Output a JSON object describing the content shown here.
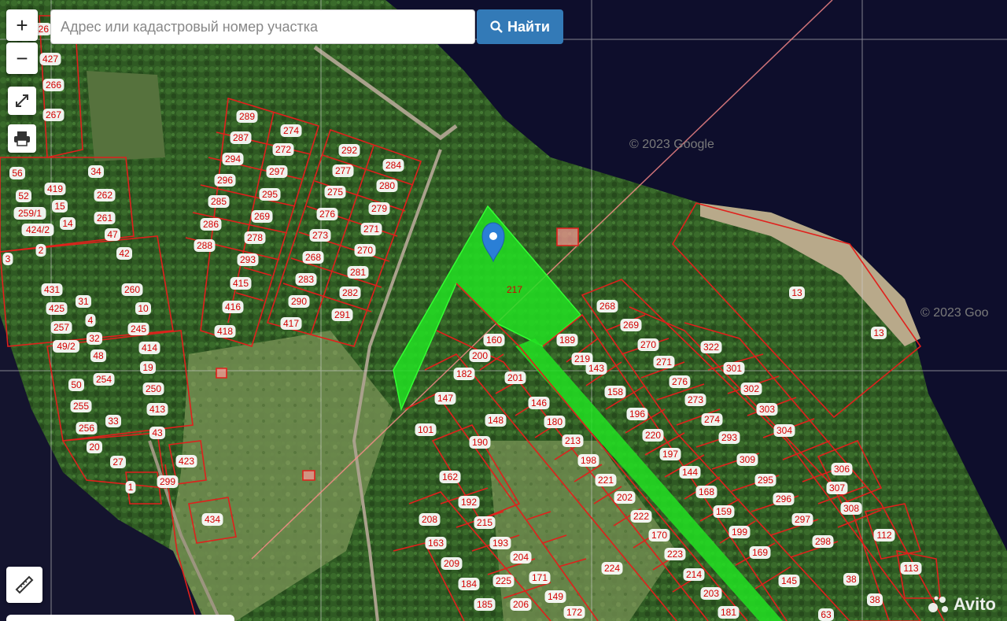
{
  "search": {
    "placeholder": "Адрес или кадастровый номер участка",
    "button_label": "Найти"
  },
  "controls": {
    "zoom_in": "+",
    "zoom_out": "−"
  },
  "watermarks": [
    "© 2023 Google",
    "© 2023 Goo"
  ],
  "avito_logo_text": "Avito",
  "highlighted_parcel": "217",
  "colors": {
    "parcel_outline": "#e0201c",
    "highlight_fill": "#22e022",
    "water": "#0e0e2c",
    "button": "#337ab7"
  },
  "parcels": [
    [
      "427",
      "64",
      "75"
    ],
    [
      "426",
      "52",
      "37"
    ],
    [
      "266",
      "68",
      "108"
    ],
    [
      "267",
      "68",
      "146"
    ],
    [
      "56",
      "22",
      "220"
    ],
    [
      "52",
      "30",
      "249"
    ],
    [
      "419",
      "70",
      "240"
    ],
    [
      "34",
      "122",
      "218"
    ],
    [
      "262",
      "133",
      "248"
    ],
    [
      "259/1",
      "38",
      "271"
    ],
    [
      "15",
      "76",
      "262"
    ],
    [
      "261",
      "133",
      "277"
    ],
    [
      "424/2",
      "48",
      "292"
    ],
    [
      "14",
      "86",
      "284"
    ],
    [
      "47",
      "143",
      "298"
    ],
    [
      "3",
      "10",
      "329"
    ],
    [
      "2",
      "52",
      "318"
    ],
    [
      "42",
      "158",
      "322"
    ],
    [
      "431",
      "66",
      "368"
    ],
    [
      "260",
      "168",
      "368"
    ],
    [
      "31",
      "106",
      "383"
    ],
    [
      "425",
      "72",
      "392"
    ],
    [
      "10",
      "182",
      "392"
    ],
    [
      "257",
      "78",
      "416"
    ],
    [
      "4",
      "115",
      "407"
    ],
    [
      "245",
      "176",
      "418"
    ],
    [
      "49/2",
      "84",
      "440"
    ],
    [
      "32",
      "120",
      "430"
    ],
    [
      "414",
      "190",
      "442"
    ],
    [
      "48",
      "125",
      "452"
    ],
    [
      "19",
      "188",
      "467"
    ],
    [
      "254",
      "132",
      "482"
    ],
    [
      "50",
      "97",
      "489"
    ],
    [
      "250",
      "195",
      "494"
    ],
    [
      "255",
      "103",
      "516"
    ],
    [
      "413",
      "200",
      "520"
    ],
    [
      "33",
      "144",
      "535"
    ],
    [
      "256",
      "110",
      "544"
    ],
    [
      "43",
      "200",
      "550"
    ],
    [
      "20",
      "120",
      "568"
    ],
    [
      "27",
      "150",
      "587"
    ],
    [
      "423",
      "237",
      "586"
    ],
    [
      "299",
      "213",
      "612"
    ],
    [
      "1",
      "166",
      "619"
    ],
    [
      "434",
      "270",
      "660"
    ],
    [
      "289",
      "314",
      "148"
    ],
    [
      "274",
      "370",
      "166"
    ],
    [
      "287",
      "306",
      "175"
    ],
    [
      "272",
      "360",
      "190"
    ],
    [
      "294",
      "296",
      "202"
    ],
    [
      "297",
      "352",
      "218"
    ],
    [
      "296",
      "286",
      "229"
    ],
    [
      "295",
      "343",
      "247"
    ],
    [
      "285",
      "278",
      "256"
    ],
    [
      "269",
      "333",
      "275"
    ],
    [
      "286",
      "268",
      "285"
    ],
    [
      "278",
      "324",
      "302"
    ],
    [
      "288",
      "260",
      "312"
    ],
    [
      "293",
      "315",
      "330"
    ],
    [
      "415",
      "306",
      "360"
    ],
    [
      "416",
      "296",
      "390"
    ],
    [
      "418",
      "286",
      "421"
    ],
    [
      "292",
      "444",
      "191"
    ],
    [
      "284",
      "500",
      "210"
    ],
    [
      "277",
      "436",
      "217"
    ],
    [
      "280",
      "492",
      "236"
    ],
    [
      "275",
      "426",
      "244"
    ],
    [
      "279",
      "482",
      "265"
    ],
    [
      "276",
      "416",
      "272"
    ],
    [
      "271",
      "472",
      "291"
    ],
    [
      "273",
      "407",
      "299"
    ],
    [
      "270",
      "464",
      "318"
    ],
    [
      "268",
      "398",
      "327"
    ],
    [
      "281",
      "455",
      "346"
    ],
    [
      "283",
      "389",
      "355"
    ],
    [
      "282",
      "445",
      "372"
    ],
    [
      "290",
      "380",
      "383"
    ],
    [
      "291",
      "435",
      "400"
    ],
    [
      "417",
      "370",
      "411"
    ],
    [
      "217",
      "654",
      "368"
    ],
    [
      "268",
      "772",
      "389"
    ],
    [
      "269",
      "802",
      "413"
    ],
    [
      "189",
      "721",
      "432"
    ],
    [
      "270",
      "824",
      "438"
    ],
    [
      "322",
      "904",
      "441"
    ],
    [
      "219",
      "740",
      "456"
    ],
    [
      "143",
      "758",
      "468"
    ],
    [
      "271",
      "844",
      "460"
    ],
    [
      "301",
      "933",
      "468"
    ],
    [
      "13",
      "1013",
      "372"
    ],
    [
      "13",
      "1117",
      "423"
    ],
    [
      "276",
      "864",
      "485"
    ],
    [
      "302",
      "955",
      "494"
    ],
    [
      "158",
      "782",
      "498"
    ],
    [
      "273",
      "884",
      "508"
    ],
    [
      "303",
      "975",
      "520"
    ],
    [
      "196",
      "810",
      "526"
    ],
    [
      "274",
      "905",
      "533"
    ],
    [
      "304",
      "997",
      "547"
    ],
    [
      "220",
      "830",
      "553"
    ],
    [
      "197",
      "852",
      "577"
    ],
    [
      "293",
      "927",
      "556"
    ],
    [
      "309",
      "950",
      "584"
    ],
    [
      "144",
      "877",
      "600"
    ],
    [
      "295",
      "973",
      "610"
    ],
    [
      "168",
      "898",
      "625"
    ],
    [
      "306",
      "1070",
      "596"
    ],
    [
      "307",
      "1064",
      "620"
    ],
    [
      "296",
      "996",
      "634"
    ],
    [
      "308",
      "1082",
      "646"
    ],
    [
      "159",
      "920",
      "650"
    ],
    [
      "297",
      "1020",
      "660"
    ],
    [
      "199",
      "940",
      "676"
    ],
    [
      "298",
      "1046",
      "688"
    ],
    [
      "112",
      "1124",
      "680"
    ],
    [
      "169",
      "966",
      "702"
    ],
    [
      "113",
      "1158",
      "722"
    ],
    [
      "145",
      "1003",
      "738"
    ],
    [
      "38",
      "1082",
      "736"
    ],
    [
      "38",
      "1112",
      "762"
    ],
    [
      "63",
      "1050",
      "781"
    ],
    [
      "182",
      "590",
      "475"
    ],
    [
      "200",
      "610",
      "452"
    ],
    [
      "160",
      "628",
      "432"
    ],
    [
      "201",
      "655",
      "480"
    ],
    [
      "147",
      "566",
      "506"
    ],
    [
      "146",
      "685",
      "512"
    ],
    [
      "148",
      "630",
      "534"
    ],
    [
      "180",
      "705",
      "536"
    ],
    [
      "101",
      "541",
      "546"
    ],
    [
      "190",
      "610",
      "562"
    ],
    [
      "213",
      "728",
      "560"
    ],
    [
      "198",
      "748",
      "585"
    ],
    [
      "221",
      "770",
      "610"
    ],
    [
      "162",
      "572",
      "606"
    ],
    [
      "192",
      "596",
      "638"
    ],
    [
      "202",
      "794",
      "632"
    ],
    [
      "222",
      "815",
      "656"
    ],
    [
      "208",
      "546",
      "660"
    ],
    [
      "215",
      "616",
      "664"
    ],
    [
      "170",
      "838",
      "680"
    ],
    [
      "163",
      "554",
      "690"
    ],
    [
      "193",
      "636",
      "690"
    ],
    [
      "223",
      "858",
      "704"
    ],
    [
      "224",
      "778",
      "722"
    ],
    [
      "204",
      "662",
      "708"
    ],
    [
      "209",
      "574",
      "716"
    ],
    [
      "214",
      "882",
      "730"
    ],
    [
      "171",
      "686",
      "734"
    ],
    [
      "184",
      "596",
      "742"
    ],
    [
      "225",
      "640",
      "738"
    ],
    [
      "203",
      "904",
      "754"
    ],
    [
      "149",
      "706",
      "758"
    ],
    [
      "185",
      "616",
      "768"
    ],
    [
      "206",
      "662",
      "768"
    ],
    [
      "172",
      "730",
      "778"
    ],
    [
      "181",
      "926",
      "778"
    ]
  ]
}
